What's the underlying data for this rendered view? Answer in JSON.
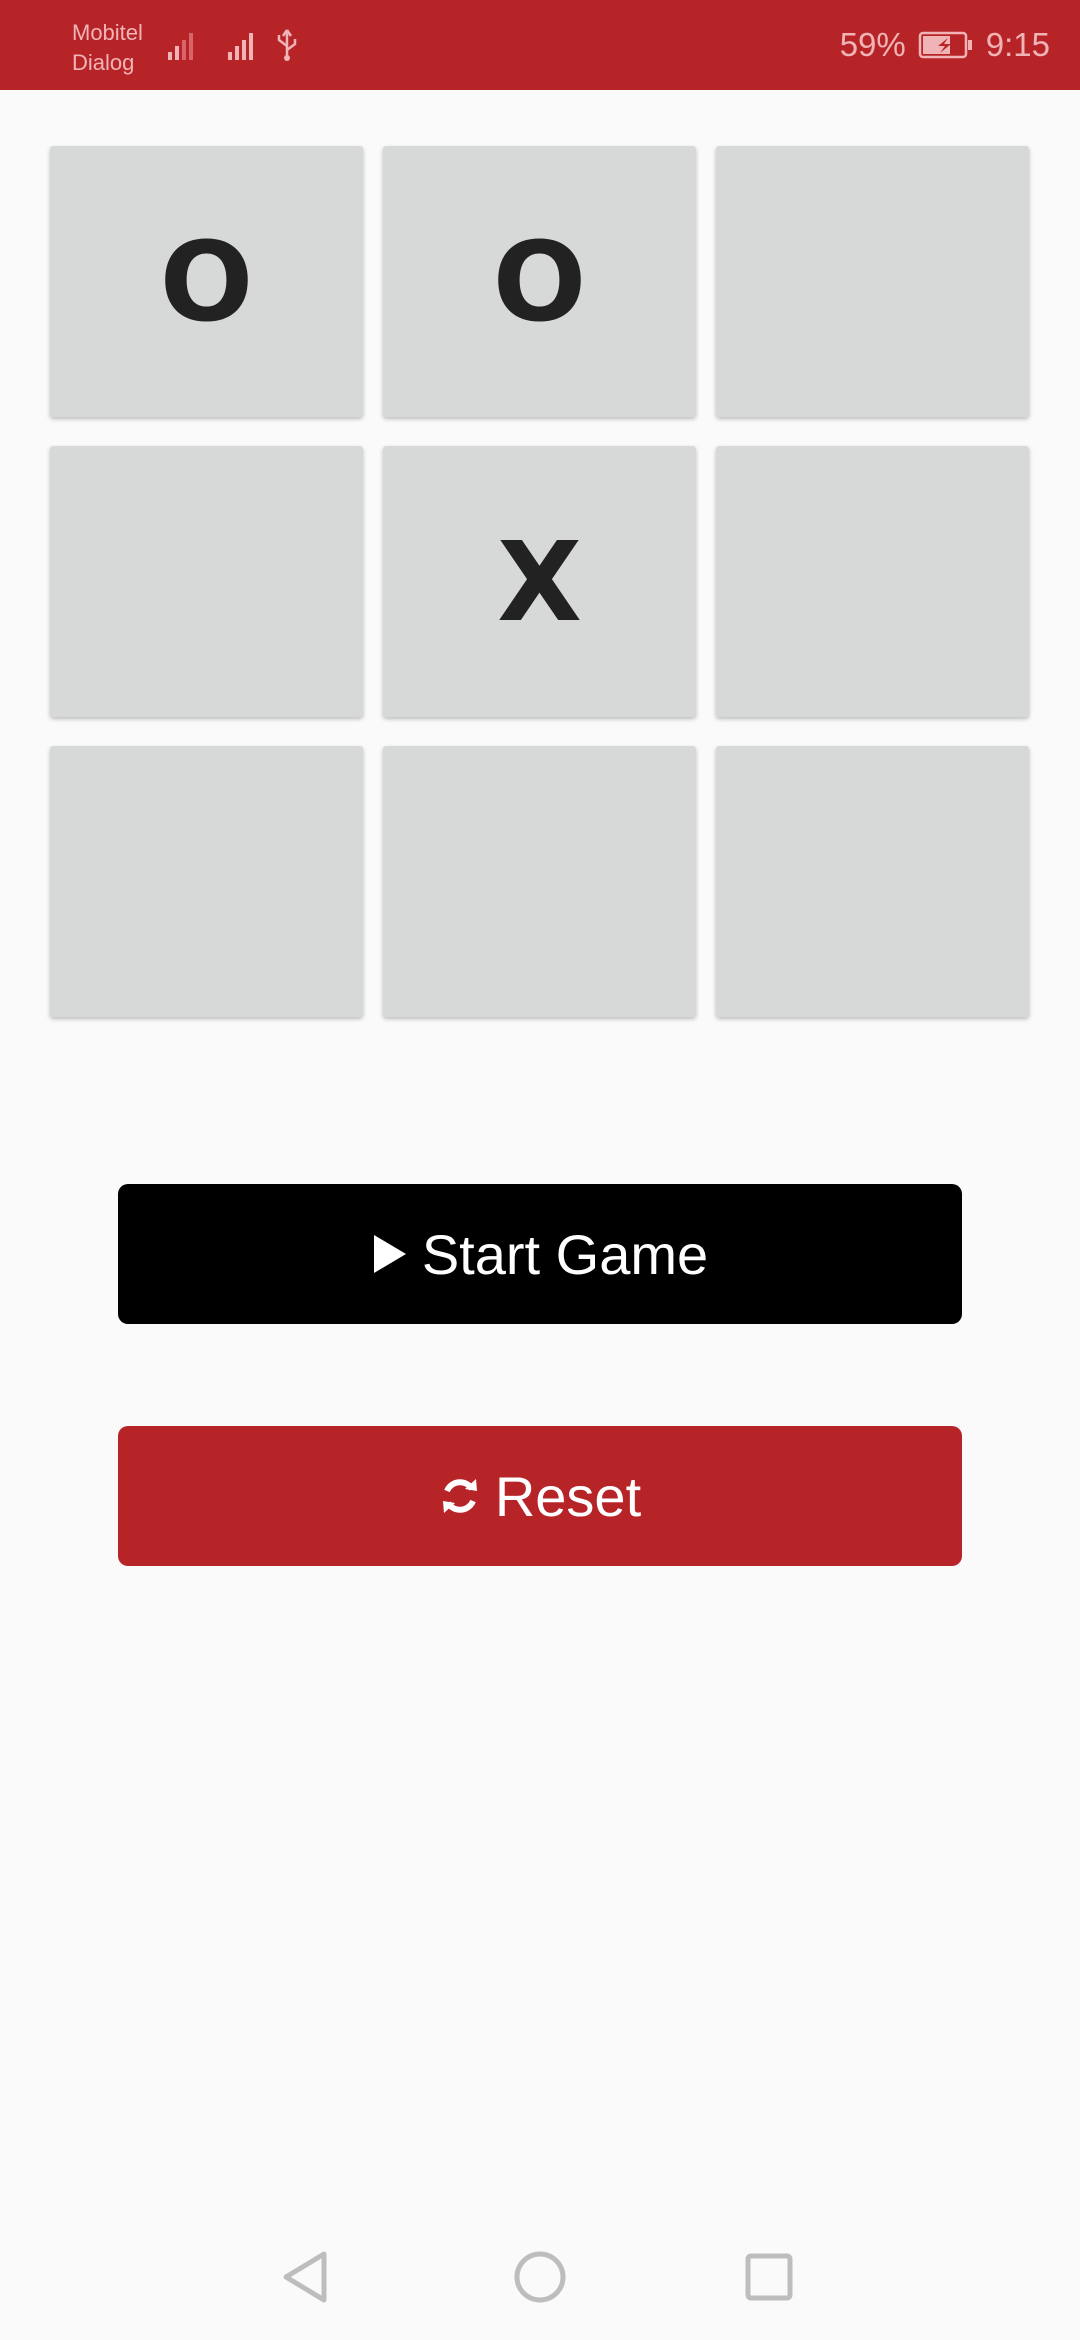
{
  "status_bar": {
    "carrier_1": "Mobitel",
    "carrier_2": "Dialog",
    "battery": "59%",
    "time": "9:15",
    "icons": [
      "signal-icon",
      "signal-icon",
      "usb-icon",
      "battery-charging-icon"
    ]
  },
  "board": {
    "cells": [
      "O",
      "O",
      "",
      "",
      "X",
      "",
      "",
      "",
      ""
    ]
  },
  "buttons": {
    "start_label": "Start Game",
    "start_icon": "play-icon",
    "reset_label": "Reset",
    "reset_icon": "refresh-icon"
  },
  "nav": {
    "icons": [
      "back-icon",
      "home-icon",
      "recents-icon"
    ]
  },
  "colors": {
    "accent": "#B72428",
    "start_button": "#000000",
    "cell": "#D7D8D8",
    "background": "#FAFAFA"
  }
}
